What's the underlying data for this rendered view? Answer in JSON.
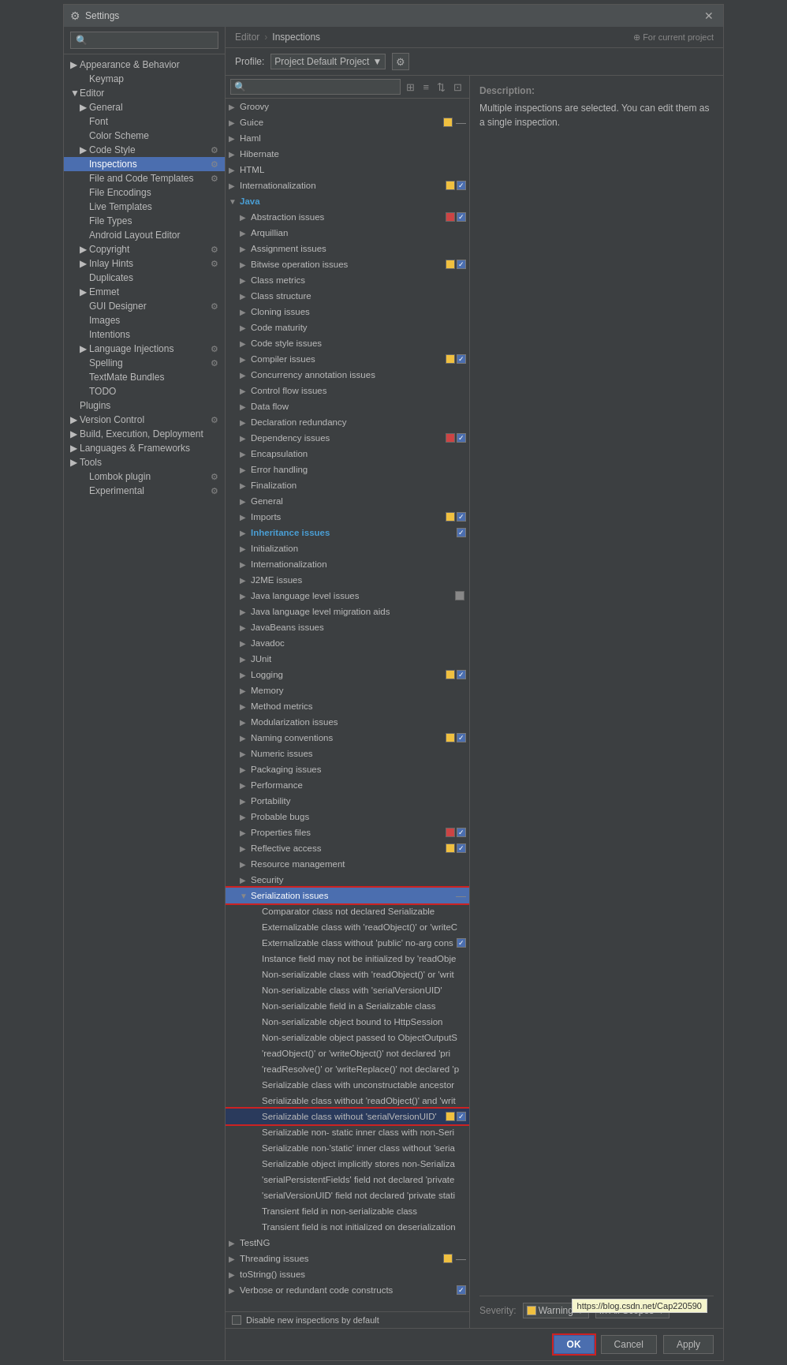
{
  "window": {
    "title": "Settings",
    "icon": "⚙"
  },
  "sidebar": {
    "search_placeholder": "🔍",
    "items": [
      {
        "id": "appearance",
        "label": "Appearance & Behavior",
        "level": 0,
        "expanded": true,
        "arrow": "▶"
      },
      {
        "id": "keymap",
        "label": "Keymap",
        "level": 1,
        "arrow": ""
      },
      {
        "id": "editor",
        "label": "Editor",
        "level": 0,
        "expanded": true,
        "arrow": "▼"
      },
      {
        "id": "general",
        "label": "General",
        "level": 1,
        "arrow": "▶"
      },
      {
        "id": "font",
        "label": "Font",
        "level": 1,
        "arrow": ""
      },
      {
        "id": "color-scheme",
        "label": "Color Scheme",
        "level": 1,
        "arrow": ""
      },
      {
        "id": "code-style",
        "label": "Code Style",
        "level": 1,
        "arrow": "▶",
        "gear": true
      },
      {
        "id": "inspections",
        "label": "Inspections",
        "level": 1,
        "arrow": "",
        "selected": true,
        "gear": true
      },
      {
        "id": "file-code-templates",
        "label": "File and Code Templates",
        "level": 1,
        "arrow": "",
        "gear": true
      },
      {
        "id": "file-encodings",
        "label": "File Encodings",
        "level": 1,
        "arrow": ""
      },
      {
        "id": "live-templates",
        "label": "Live Templates",
        "level": 1,
        "arrow": ""
      },
      {
        "id": "file-types",
        "label": "File Types",
        "level": 1,
        "arrow": ""
      },
      {
        "id": "android-layout",
        "label": "Android Layout Editor",
        "level": 1,
        "arrow": ""
      },
      {
        "id": "copyright",
        "label": "Copyright",
        "level": 1,
        "arrow": "▶",
        "gear": true
      },
      {
        "id": "inlay-hints",
        "label": "Inlay Hints",
        "level": 1,
        "arrow": "▶",
        "gear": true
      },
      {
        "id": "duplicates",
        "label": "Duplicates",
        "level": 1,
        "arrow": ""
      },
      {
        "id": "emmet",
        "label": "Emmet",
        "level": 1,
        "arrow": "▶"
      },
      {
        "id": "gui-designer",
        "label": "GUI Designer",
        "level": 1,
        "arrow": "",
        "gear": true
      },
      {
        "id": "images",
        "label": "Images",
        "level": 1,
        "arrow": ""
      },
      {
        "id": "intentions",
        "label": "Intentions",
        "level": 1,
        "arrow": ""
      },
      {
        "id": "language-injections",
        "label": "Language Injections",
        "level": 1,
        "arrow": "▶",
        "gear": true
      },
      {
        "id": "spelling",
        "label": "Spelling",
        "level": 1,
        "arrow": "",
        "gear": true
      },
      {
        "id": "textmate-bundles",
        "label": "TextMate Bundles",
        "level": 1,
        "arrow": ""
      },
      {
        "id": "todo",
        "label": "TODO",
        "level": 1,
        "arrow": ""
      },
      {
        "id": "plugins",
        "label": "Plugins",
        "level": 0,
        "arrow": ""
      },
      {
        "id": "version-control",
        "label": "Version Control",
        "level": 0,
        "arrow": "▶",
        "gear": true
      },
      {
        "id": "build-execution",
        "label": "Build, Execution, Deployment",
        "level": 0,
        "arrow": "▶"
      },
      {
        "id": "languages-frameworks",
        "label": "Languages & Frameworks",
        "level": 0,
        "arrow": "▶"
      },
      {
        "id": "tools",
        "label": "Tools",
        "level": 0,
        "arrow": "▶"
      },
      {
        "id": "lombok-plugin",
        "label": "Lombok plugin",
        "level": 1,
        "arrow": "",
        "gear": true
      },
      {
        "id": "experimental",
        "label": "Experimental",
        "level": 1,
        "arrow": "",
        "gear": true
      }
    ]
  },
  "breadcrumb": {
    "items": [
      "Editor",
      "Inspections"
    ],
    "for_current": "⊕ For current project"
  },
  "profile": {
    "label": "Profile:",
    "value": "Project Default",
    "suffix": "Project"
  },
  "inspections": {
    "groups": [
      {
        "id": "groovy",
        "label": "Groovy",
        "expanded": false,
        "level": 0
      },
      {
        "id": "guice",
        "label": "Guice",
        "expanded": false,
        "level": 0,
        "colorBox": "yellow"
      },
      {
        "id": "haml",
        "label": "Haml",
        "expanded": false,
        "level": 0
      },
      {
        "id": "hibernate",
        "label": "Hibernate",
        "expanded": false,
        "level": 0
      },
      {
        "id": "html",
        "label": "HTML",
        "expanded": false,
        "level": 0
      },
      {
        "id": "internationalization",
        "label": "Internationalization",
        "expanded": false,
        "level": 0,
        "colorBox": "yellow",
        "checked": true
      },
      {
        "id": "java",
        "label": "Java",
        "expanded": true,
        "level": 0,
        "selected": false
      },
      {
        "id": "abstraction-issues",
        "label": "Abstraction issues",
        "expanded": false,
        "level": 1,
        "colorBox": "red",
        "checked": true
      },
      {
        "id": "arquillian",
        "label": "Arquillian",
        "expanded": false,
        "level": 1
      },
      {
        "id": "assignment-issues",
        "label": "Assignment issues",
        "expanded": false,
        "level": 1
      },
      {
        "id": "bitwise-op",
        "label": "Bitwise operation issues",
        "expanded": false,
        "level": 1,
        "colorBox": "yellow",
        "checked": true
      },
      {
        "id": "class-metrics",
        "label": "Class metrics",
        "expanded": false,
        "level": 1
      },
      {
        "id": "class-structure",
        "label": "Class structure",
        "expanded": false,
        "level": 1
      },
      {
        "id": "cloning-issues",
        "label": "Cloning issues",
        "expanded": false,
        "level": 1
      },
      {
        "id": "code-maturity",
        "label": "Code maturity",
        "expanded": false,
        "level": 1
      },
      {
        "id": "code-style-issues",
        "label": "Code style issues",
        "expanded": false,
        "level": 1
      },
      {
        "id": "compiler-issues",
        "label": "Compiler issues",
        "expanded": false,
        "level": 1,
        "colorBox": "yellow",
        "checked": true
      },
      {
        "id": "concurrency-annotation",
        "label": "Concurrency annotation issues",
        "expanded": false,
        "level": 1
      },
      {
        "id": "control-flow",
        "label": "Control flow issues",
        "expanded": false,
        "level": 1
      },
      {
        "id": "data-flow",
        "label": "Data flow",
        "expanded": false,
        "level": 1
      },
      {
        "id": "declaration-redundancy",
        "label": "Declaration redundancy",
        "expanded": false,
        "level": 1
      },
      {
        "id": "dependency-issues",
        "label": "Dependency issues",
        "expanded": false,
        "level": 1,
        "colorBox": "red",
        "checked": true
      },
      {
        "id": "encapsulation",
        "label": "Encapsulation",
        "expanded": false,
        "level": 1
      },
      {
        "id": "error-handling",
        "label": "Error handling",
        "expanded": false,
        "level": 1
      },
      {
        "id": "finalization",
        "label": "Finalization",
        "expanded": false,
        "level": 1
      },
      {
        "id": "general-java",
        "label": "General",
        "expanded": false,
        "level": 1
      },
      {
        "id": "imports",
        "label": "Imports",
        "expanded": false,
        "level": 1,
        "colorBox": "yellow",
        "checked": true
      },
      {
        "id": "inheritance-issues",
        "label": "Inheritance issues",
        "expanded": false,
        "level": 1,
        "highlighted": true,
        "checked": true
      },
      {
        "id": "initialization",
        "label": "Initialization",
        "expanded": false,
        "level": 1
      },
      {
        "id": "internationalization-java",
        "label": "Internationalization",
        "expanded": false,
        "level": 1
      },
      {
        "id": "j2me-issues",
        "label": "J2ME issues",
        "expanded": false,
        "level": 1
      },
      {
        "id": "java-lang-level",
        "label": "Java language level issues",
        "expanded": false,
        "level": 1,
        "colorBox": "gray"
      },
      {
        "id": "java-lang-migration",
        "label": "Java language level migration aids",
        "expanded": false,
        "level": 1
      },
      {
        "id": "javabeans-issues",
        "label": "JavaBeans issues",
        "expanded": false,
        "level": 1
      },
      {
        "id": "javadoc",
        "label": "Javadoc",
        "expanded": false,
        "level": 1
      },
      {
        "id": "junit",
        "label": "JUnit",
        "expanded": false,
        "level": 1
      },
      {
        "id": "logging",
        "label": "Logging",
        "expanded": false,
        "level": 1,
        "colorBox": "yellow",
        "checked": true
      },
      {
        "id": "memory",
        "label": "Memory",
        "expanded": false,
        "level": 1
      },
      {
        "id": "method-metrics",
        "label": "Method metrics",
        "expanded": false,
        "level": 1
      },
      {
        "id": "modularization",
        "label": "Modularization issues",
        "expanded": false,
        "level": 1
      },
      {
        "id": "naming-conventions",
        "label": "Naming conventions",
        "expanded": false,
        "level": 1,
        "colorBox": "yellow",
        "checked": true
      },
      {
        "id": "numeric-issues",
        "label": "Numeric issues",
        "expanded": false,
        "level": 1
      },
      {
        "id": "packaging-issues",
        "label": "Packaging issues",
        "expanded": false,
        "level": 1
      },
      {
        "id": "performance",
        "label": "Performance",
        "expanded": false,
        "level": 1
      },
      {
        "id": "portability",
        "label": "Portability",
        "expanded": false,
        "level": 1
      },
      {
        "id": "probable-bugs",
        "label": "Probable bugs",
        "expanded": false,
        "level": 1
      },
      {
        "id": "properties-files",
        "label": "Properties files",
        "expanded": false,
        "level": 1,
        "colorBox": "red",
        "checked": true
      },
      {
        "id": "reflective-access",
        "label": "Reflective access",
        "expanded": false,
        "level": 1,
        "colorBox": "yellow",
        "checked": true
      },
      {
        "id": "resource-management",
        "label": "Resource management",
        "expanded": false,
        "level": 1
      },
      {
        "id": "security",
        "label": "Security",
        "expanded": false,
        "level": 1
      },
      {
        "id": "serialization-issues",
        "label": "Serialization issues",
        "expanded": true,
        "level": 1,
        "selected": true
      },
      {
        "id": "comparator",
        "label": "Comparator class not declared Serializable",
        "expanded": false,
        "level": 2
      },
      {
        "id": "externalizable-readwrite",
        "label": "Externalizable class with 'readObject()' or 'writeC",
        "expanded": false,
        "level": 2
      },
      {
        "id": "externalizable-public",
        "label": "Externalizable class without 'public' no-arg cons",
        "expanded": false,
        "level": 2,
        "checked": true
      },
      {
        "id": "instance-field-readobj",
        "label": "Instance field may not be initialized by 'readObje",
        "expanded": false,
        "level": 2
      },
      {
        "id": "non-serial-readobj",
        "label": "Non-serializable class with 'readObject()' or 'writ",
        "expanded": false,
        "level": 2
      },
      {
        "id": "non-serial-versionuid",
        "label": "Non-serializable class with 'serialVersionUID'",
        "expanded": false,
        "level": 2
      },
      {
        "id": "non-serial-field",
        "label": "Non-serializable field in a Serializable class",
        "expanded": false,
        "level": 2
      },
      {
        "id": "non-serial-httpsession",
        "label": "Non-serializable object bound to HttpSession",
        "expanded": false,
        "level": 2
      },
      {
        "id": "non-serial-objectoutput",
        "label": "Non-serializable object passed to ObjectOutputS",
        "expanded": false,
        "level": 2
      },
      {
        "id": "readobj-writeobj-pri",
        "label": "'readObject()' or 'writeObject()' not declared 'pri",
        "expanded": false,
        "level": 2
      },
      {
        "id": "readresolve-writereplace",
        "label": "'readResolve()' or 'writeReplace()' not declared 'p",
        "expanded": false,
        "level": 2
      },
      {
        "id": "serial-unconstructable",
        "label": "Serializable class with unconstructable ancestor",
        "expanded": false,
        "level": 2
      },
      {
        "id": "serial-without-readobj",
        "label": "Serializable class without 'readObject()' and 'writ",
        "expanded": false,
        "level": 2
      },
      {
        "id": "serial-without-versionuid",
        "label": "Serializable class without 'serialVersionUID'",
        "expanded": false,
        "level": 2,
        "colorBox": "yellow",
        "checked": true,
        "highlighted_row": true
      },
      {
        "id": "serial-nonstatic-inner",
        "label": "Serializable non- static inner class with non-Seri",
        "expanded": false,
        "level": 2
      },
      {
        "id": "serial-nonstatic-inner2",
        "label": "Serializable non-'static' inner class without 'seria",
        "expanded": false,
        "level": 2
      },
      {
        "id": "serial-object-nonstatic",
        "label": "Serializable object implicitly stores non-Serializa",
        "expanded": false,
        "level": 2
      },
      {
        "id": "serialpersistentfields",
        "label": "'serialPersistentFields' field not declared 'private",
        "expanded": false,
        "level": 2
      },
      {
        "id": "serialversionuid-private",
        "label": "'serialVersionUID' field not declared 'private stati",
        "expanded": false,
        "level": 2
      },
      {
        "id": "transient-nonserial",
        "label": "Transient field in non-serializable class",
        "expanded": false,
        "level": 2
      },
      {
        "id": "transient-deserialization",
        "label": "Transient field is not initialized on deserialization",
        "expanded": false,
        "level": 2
      },
      {
        "id": "testng",
        "label": "TestNG",
        "expanded": false,
        "level": 0
      },
      {
        "id": "threading-issues",
        "label": "Threading issues",
        "expanded": false,
        "level": 0,
        "colorBox": "yellow"
      },
      {
        "id": "tostring-issues",
        "label": "toString() issues",
        "expanded": false,
        "level": 0
      },
      {
        "id": "verbose-code",
        "label": "Verbose or redundant code constructs",
        "expanded": false,
        "level": 0,
        "checked": true
      }
    ],
    "disable_new_label": "Disable new inspections by default"
  },
  "description": {
    "label": "Description:",
    "text": "Multiple inspections are selected. You can edit them as a single inspection."
  },
  "severity": {
    "label": "Severity:",
    "color": "yellow",
    "value": "Warning",
    "scope": "In All Scopes"
  },
  "buttons": {
    "ok": "OK",
    "cancel": "Cancel",
    "apply": "Apply"
  },
  "url": "https://blog.csdn.net/Cap220590"
}
